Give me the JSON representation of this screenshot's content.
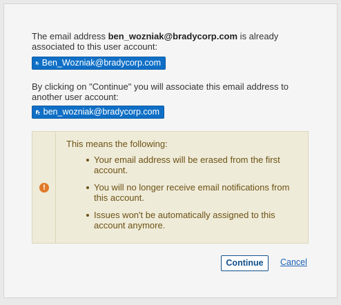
{
  "dialog": {
    "para1": {
      "prefix": "The email address ",
      "email_bold": "ben_wozniak@bradycorp.com",
      "suffix": " is already associated to this user account:"
    },
    "user_tag_1": "Ben_Wozniak@bradycorp.com",
    "para2": "By clicking on \"Continue\" you will associate this email address to another user account:",
    "user_tag_2": "ben_wozniak@bradycorp.com",
    "warning": {
      "title": "This means the following:",
      "items": [
        "Your email address will be erased from the first account.",
        "You will no longer receive email notifications from this account.",
        "Issues won't be automatically assigned to this account anymore."
      ]
    },
    "continue_label": "Continue",
    "cancel_label": "Cancel",
    "colors": {
      "tag_bg": "#0f6fc6",
      "warning_bg": "#efebd9",
      "warning_icon": "#e07a2a",
      "button_border": "#0f4f8a"
    },
    "icons": {
      "user_tag": "user-icon",
      "warning": "warning-icon"
    }
  }
}
